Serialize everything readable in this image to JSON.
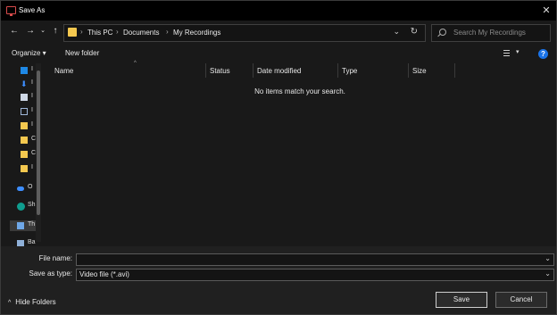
{
  "window": {
    "title": "Save As"
  },
  "address": {
    "crumbs": [
      "This PC",
      "Documents",
      "My Recordings"
    ],
    "separator": "›"
  },
  "search": {
    "placeholder": "Search My Recordings"
  },
  "toolbar": {
    "organize": "Organize ▾",
    "new_folder": "New folder"
  },
  "nav_pane": {
    "items": [
      {
        "icon": "quick-access-icon",
        "label": "I"
      },
      {
        "icon": "downloads-icon",
        "label": "I"
      },
      {
        "icon": "documents-icon",
        "label": "I"
      },
      {
        "icon": "pictures-icon",
        "label": "I"
      },
      {
        "icon": "folder-icon",
        "label": "I"
      },
      {
        "icon": "folder-icon",
        "label": "C"
      },
      {
        "icon": "folder-icon",
        "label": "C"
      },
      {
        "icon": "folder-icon",
        "label": "I"
      },
      {
        "icon": "onedrive-icon",
        "label": "O"
      },
      {
        "icon": "sharepoint-icon",
        "label": "Sh"
      },
      {
        "icon": "this-pc-icon",
        "label": "Th"
      },
      {
        "icon": "network-icon",
        "label": "Ba"
      }
    ]
  },
  "columns": [
    "Name",
    "Status",
    "Date modified",
    "Type",
    "Size"
  ],
  "empty_message": "No items match your search.",
  "form": {
    "file_name_label": "File name:",
    "file_name_value": "",
    "save_type_label": "Save as type:",
    "save_type_value": "Video file (*.avi)"
  },
  "footer": {
    "hide_folders": "Hide Folders",
    "save": "Save",
    "cancel": "Cancel"
  },
  "colors": {
    "folder": "#f4c84f",
    "accent": "#1a73e8",
    "title_icon": "#d94c4c"
  }
}
